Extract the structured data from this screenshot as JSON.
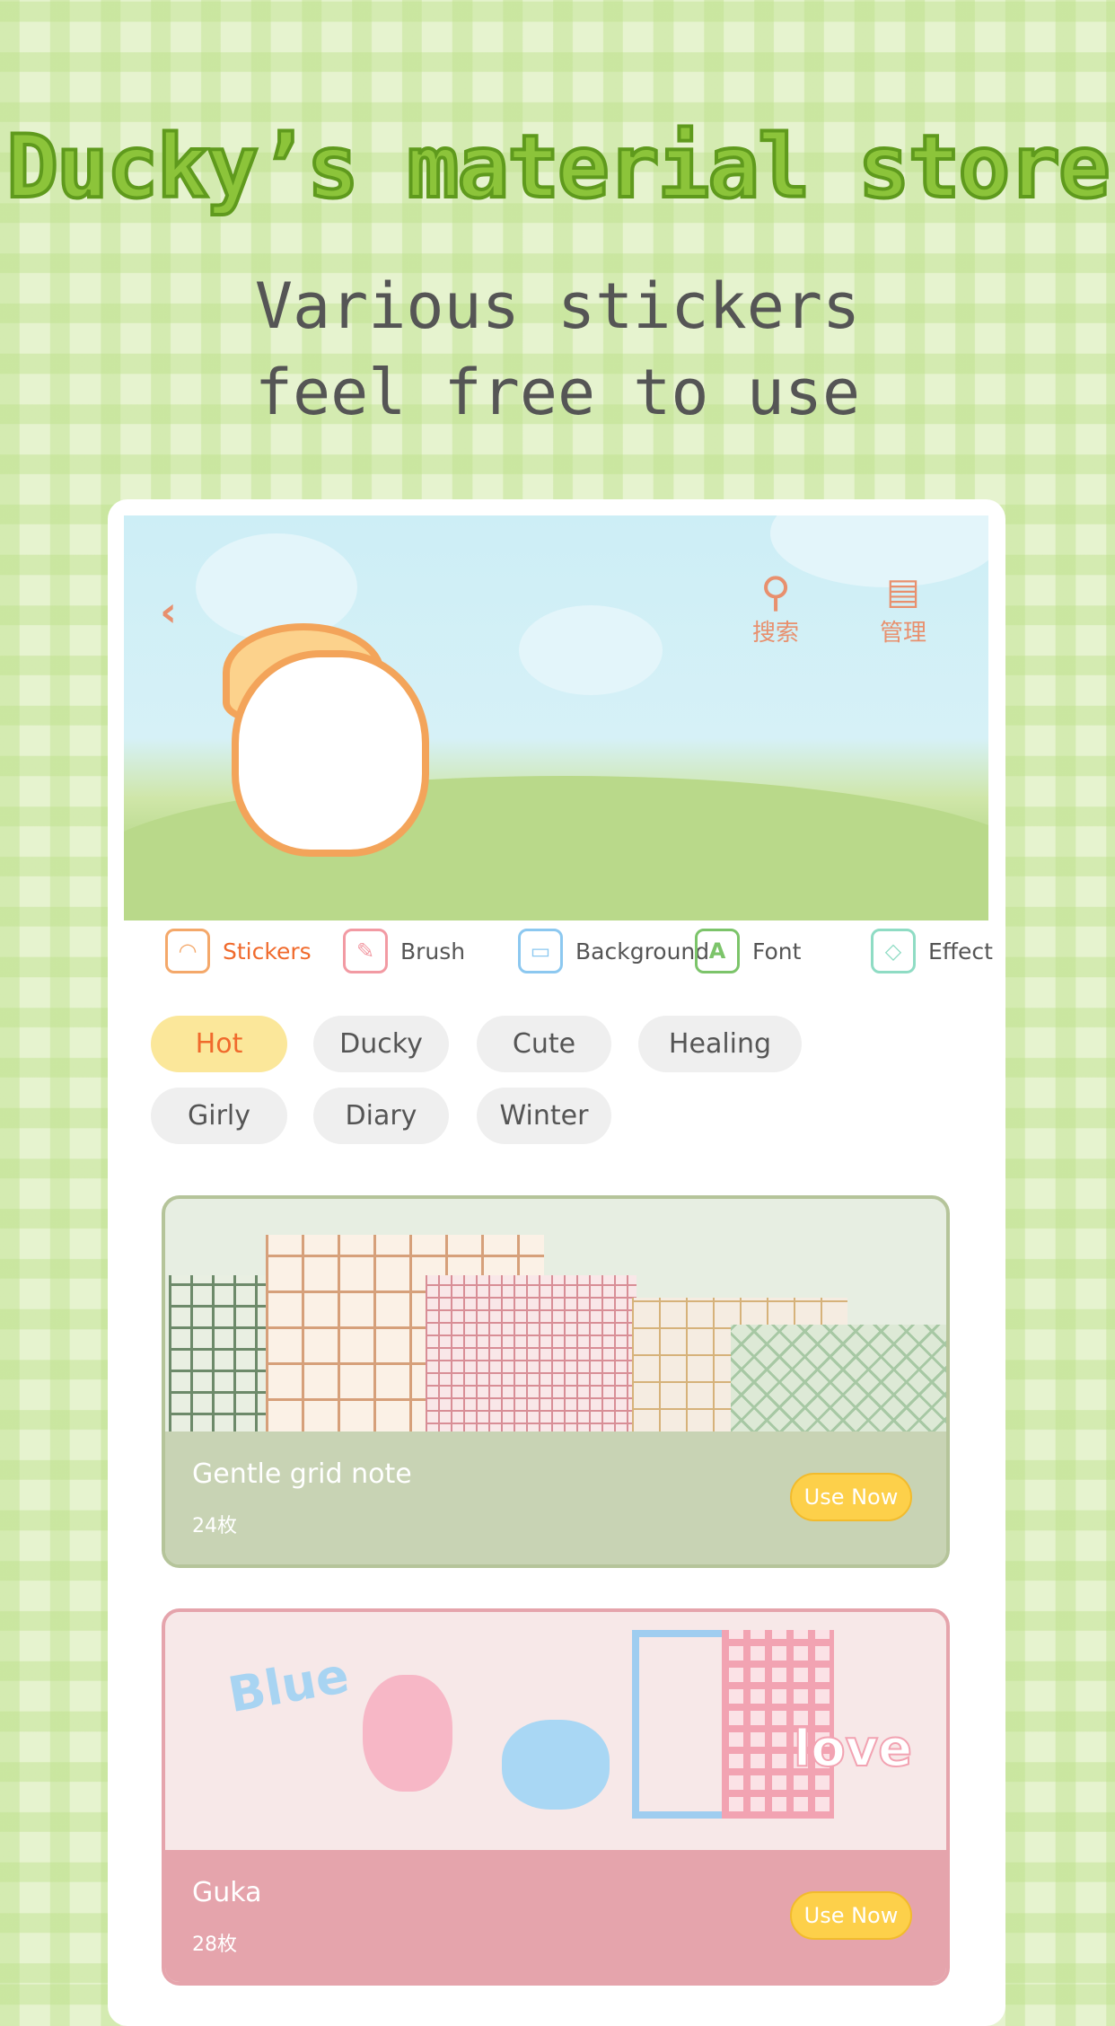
{
  "promo": {
    "title": "Ducky’s material store",
    "subtitle_line1": "Various stickers",
    "subtitle_line2": "feel free to use"
  },
  "header": {
    "back_icon": "chevron-left-icon",
    "search_label": "搜索",
    "manage_label": "管理"
  },
  "categories": [
    {
      "label": "Stickers",
      "icon": "duck-icon",
      "color": "#f4a86a",
      "active": true
    },
    {
      "label": "Brush",
      "icon": "brush-icon",
      "color": "#f29aa3"
    },
    {
      "label": "Background",
      "icon": "background-icon",
      "color": "#8cc8f0"
    },
    {
      "label": "Font",
      "icon": "font-icon",
      "color": "#7cc46a"
    },
    {
      "label": "Effect",
      "icon": "effect-icon",
      "color": "#8fdcc4"
    }
  ],
  "tags": [
    "Hot",
    "Ducky",
    "Cute",
    "Healing",
    "Girly",
    "Diary",
    "Winter"
  ],
  "active_tag": "Hot",
  "packs": [
    {
      "name": "Gentle grid note",
      "count": "24枚",
      "button": "Use Now",
      "color": "#c8d3b4"
    },
    {
      "name": "Guka",
      "count": "28枚",
      "button": "Use Now",
      "color": "#e5a4ac"
    }
  ],
  "decor_text": {
    "blue": "Blue",
    "love": "love"
  },
  "colors": {
    "accent": "#f06a2c",
    "title_green": "#8cc43a",
    "active_chip": "#fbe79a"
  }
}
